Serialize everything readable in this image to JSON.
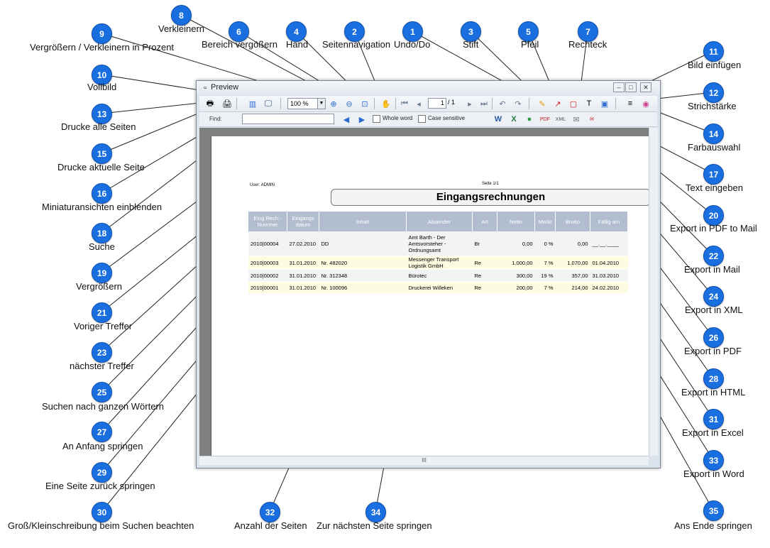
{
  "window": {
    "title": "Preview",
    "zoom_value": "100 %",
    "page_current": "1",
    "page_total": "/ 1",
    "find_label": "Find:",
    "whole_word_label": "Whole word",
    "case_sensitive_label": "Case sensitive",
    "hscroll_grip": "III"
  },
  "report": {
    "user_line": "User:   ADMIN",
    "page_line": "Seite 1/1",
    "title": "Eingangsrechnungen",
    "columns": [
      "Eing.Rech.-Nummer",
      "Eingangs datum",
      "Inhalt",
      "Absender",
      "Art",
      "Netto",
      "MwSt",
      "Brutto",
      "Fällig am"
    ],
    "rows": [
      [
        "2010|00004",
        "27.02.2010",
        "DD",
        "Amt Barth - Der Amtsvorsteher - Ordnungsamt",
        "Br",
        "0,00",
        "0 %",
        "0,00",
        "__.__.____"
      ],
      [
        "2010|00003",
        "31.01.2010",
        "Nr. 482020",
        "Messenger Transport Logistik GmbH",
        "Re",
        "1.000,00",
        "7 %",
        "1.070,00",
        "01.04.2010"
      ],
      [
        "2010|00002",
        "31.01.2010",
        "Nr. 312348",
        "Bürotec",
        "Re",
        "300,00",
        "19 %",
        "357,00",
        "31.03.2010"
      ],
      [
        "2010|00001",
        "31.01.2010",
        "Nr. 100096",
        "Druckerei Willeken",
        "Re",
        "200,00",
        "7 %",
        "214,00",
        "24.02.2010"
      ]
    ]
  },
  "callouts": [
    {
      "n": "1",
      "label": "Undo/Do"
    },
    {
      "n": "2",
      "label": "Seitennavigation"
    },
    {
      "n": "3",
      "label": "Stift"
    },
    {
      "n": "4",
      "label": "Hand"
    },
    {
      "n": "5",
      "label": "Pfeil"
    },
    {
      "n": "6",
      "label": "Bereich vergößern"
    },
    {
      "n": "7",
      "label": "Rechteck"
    },
    {
      "n": "8",
      "label": "Verkleinern"
    },
    {
      "n": "9",
      "label": "Vergrößern / Verkleinern in Prozent"
    },
    {
      "n": "10",
      "label": "Vollbild"
    },
    {
      "n": "11",
      "label": "Bild einfügen"
    },
    {
      "n": "12",
      "label": "Strichstärke"
    },
    {
      "n": "13",
      "label": "Drucke alle Seiten"
    },
    {
      "n": "14",
      "label": "Farbauswahl"
    },
    {
      "n": "15",
      "label": "Drucke aktuelle Seite"
    },
    {
      "n": "16",
      "label": "Miniaturansichten einblenden"
    },
    {
      "n": "17",
      "label": "Text eingeben"
    },
    {
      "n": "18",
      "label": "Suche"
    },
    {
      "n": "19",
      "label": "Vergrößern"
    },
    {
      "n": "20",
      "label": "Export in PDF to Mail"
    },
    {
      "n": "21",
      "label": "Voriger Treffer"
    },
    {
      "n": "22",
      "label": "Export in  Mail"
    },
    {
      "n": "23",
      "label": "nächster Treffer"
    },
    {
      "n": "24",
      "label": "Export in XML"
    },
    {
      "n": "25",
      "label": "Suchen nach ganzen Wörtern"
    },
    {
      "n": "26",
      "label": "Export in PDF"
    },
    {
      "n": "27",
      "label": "An Anfang springen"
    },
    {
      "n": "28",
      "label": "Export in HTML"
    },
    {
      "n": "29",
      "label": "Eine Seite zurück springen"
    },
    {
      "n": "30",
      "label": "Groß/Kleinschreibung beim Suchen beachten"
    },
    {
      "n": "31",
      "label": "Export in Excel"
    },
    {
      "n": "32",
      "label": "Anzahl der Seiten"
    },
    {
      "n": "33",
      "label": "Export in Word"
    },
    {
      "n": "34",
      "label": "Zur nächsten Seite springen"
    },
    {
      "n": "35",
      "label": "Ans Ende springen"
    }
  ],
  "colors": {
    "badge": "#1a6fe0",
    "header": "#b2bed0",
    "row_alt": "#fdfbe0"
  }
}
